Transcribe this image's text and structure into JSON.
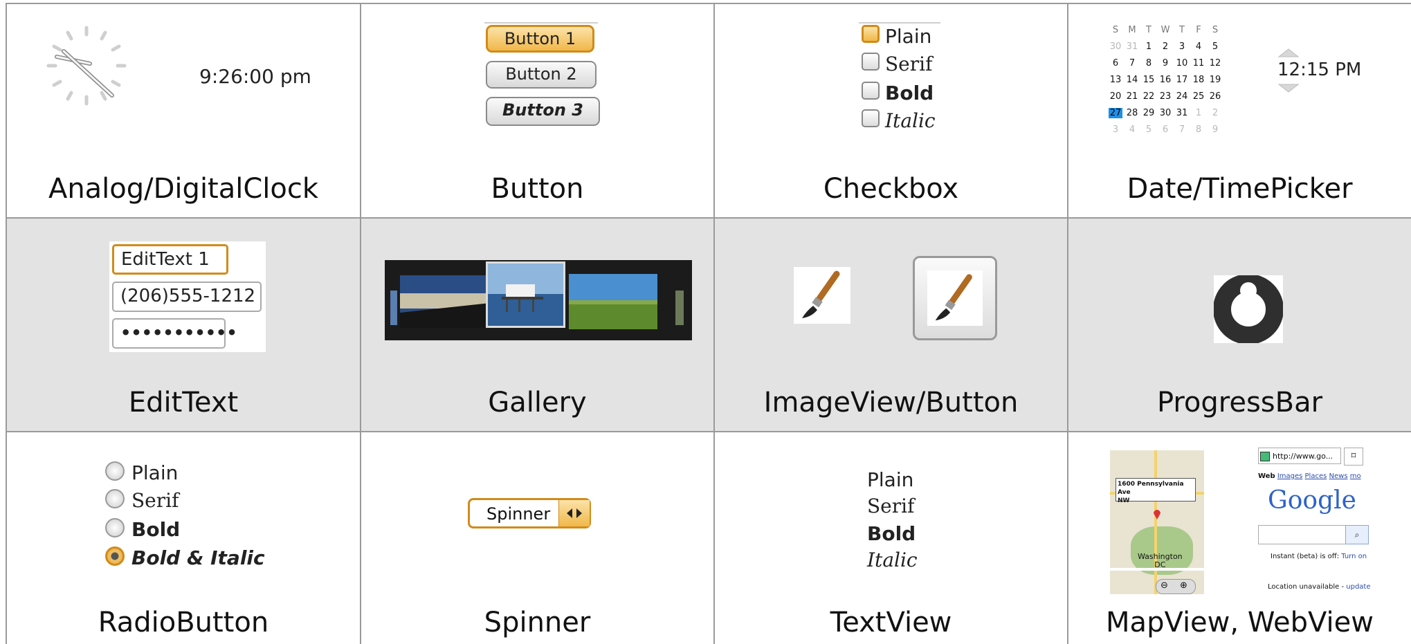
{
  "captions": {
    "clock": "Analog/DigitalClock",
    "button": "Button",
    "checkbox": "Checkbox",
    "datetime": "Date/TimePicker",
    "edittext": "EditText",
    "gallery": "Gallery",
    "imageview": "ImageView/Button",
    "progress": "ProgressBar",
    "radio": "RadioButton",
    "spinner": "Spinner",
    "textview": "TextView",
    "mapweb": "MapView, WebView"
  },
  "clock": {
    "digital_time": "9:26:00 pm"
  },
  "buttons": [
    "Button 1",
    "Button 2",
    "Button 3"
  ],
  "checkboxes": [
    {
      "label": "Plain",
      "checked": false
    },
    {
      "label": "Serif",
      "checked": false
    },
    {
      "label": "Bold",
      "checked": false
    },
    {
      "label": "Italic",
      "checked": false
    }
  ],
  "datepicker": {
    "weekdays": [
      "S",
      "M",
      "T",
      "W",
      "T",
      "F",
      "S"
    ],
    "rows": [
      [
        "30",
        "31",
        "1",
        "2",
        "3",
        "4",
        "5"
      ],
      [
        "6",
        "7",
        "8",
        "9",
        "10",
        "11",
        "12"
      ],
      [
        "13",
        "14",
        "15",
        "16",
        "17",
        "18",
        "19"
      ],
      [
        "20",
        "21",
        "22",
        "23",
        "24",
        "25",
        "26"
      ],
      [
        "27",
        "28",
        "29",
        "30",
        "31",
        "1",
        "2"
      ],
      [
        "3",
        "4",
        "5",
        "6",
        "7",
        "8",
        "9"
      ]
    ],
    "selected": "27",
    "accent": "#1e8fe8"
  },
  "timepicker": {
    "hour": "12",
    "minute": "15",
    "ampm": "PM"
  },
  "edittext": {
    "field1": "EditText 1",
    "field2": "(206)555-1212",
    "field3": "•••••••••••"
  },
  "radios": [
    {
      "label": "Plain",
      "selected": false
    },
    {
      "label": "Serif",
      "selected": false
    },
    {
      "label": "Bold",
      "selected": false
    },
    {
      "label": "Bold & Italic",
      "selected": true
    }
  ],
  "spinner": {
    "value": "Spinner"
  },
  "textview": [
    "Plain",
    "Serif",
    "Bold",
    "Italic"
  ],
  "map": {
    "address_line1": "1600 Pennsylvania Ave",
    "address_line2": "NW",
    "city_line1": "Washington",
    "city_line2": "DC"
  },
  "web": {
    "url": "http://www.go...",
    "tabs": [
      "Web",
      "Images",
      "Places",
      "News",
      "mo"
    ],
    "logo": "Google",
    "instant_text": "Instant (beta) is off:",
    "instant_link": "Turn on",
    "location_text": "Location unavailable -",
    "location_link": "update"
  },
  "colors": {
    "focus_orange": "#d18b1a",
    "grid_line": "#9a9a9a",
    "row_gray": "#e3e3e3"
  }
}
